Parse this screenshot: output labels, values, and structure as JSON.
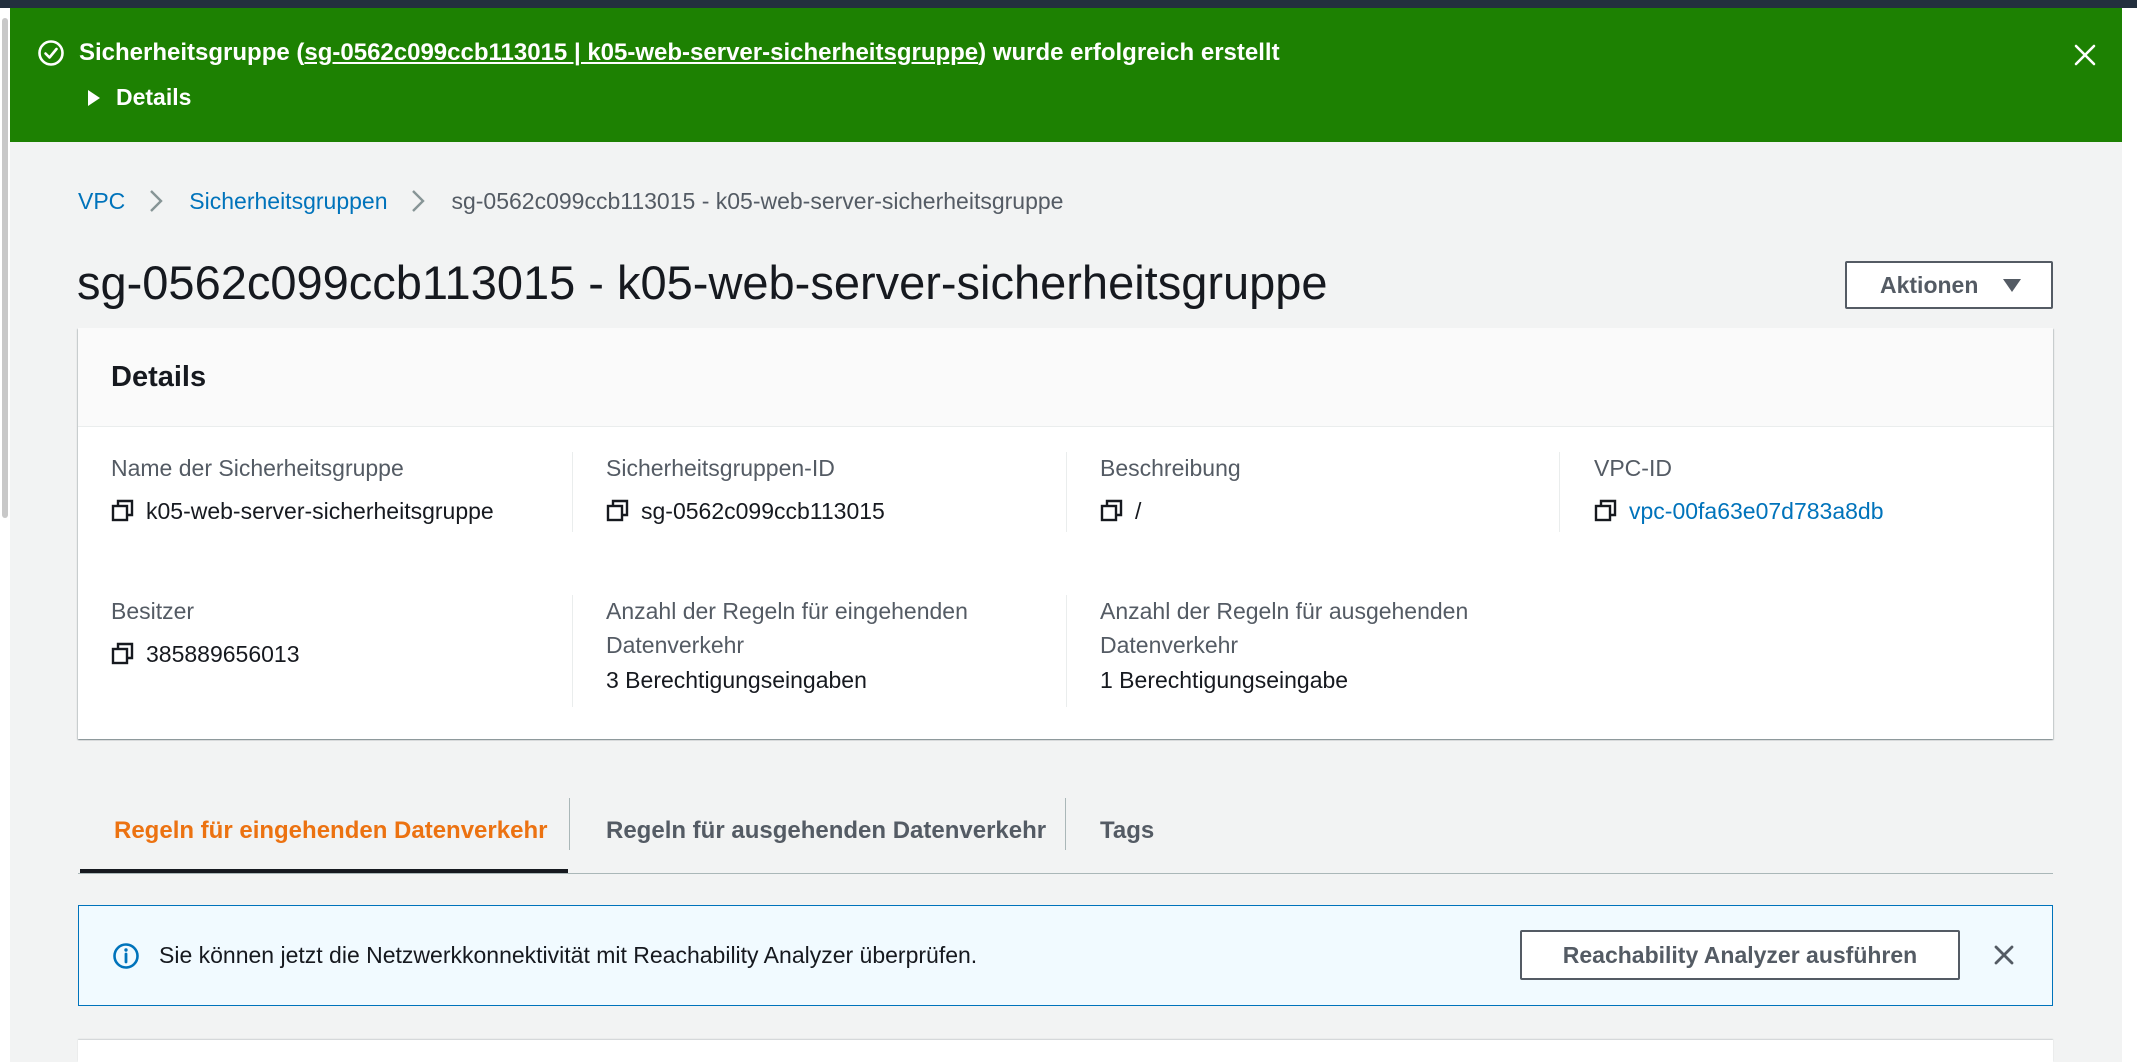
{
  "flash": {
    "prefix": "Sicherheitsgruppe (",
    "link_text": "sg-0562c099ccb113015 | k05-web-server-sicherheitsgruppe",
    "suffix": ") wurde erfolgreich erstellt",
    "details_label": "Details",
    "bg_color": "#1d8102"
  },
  "breadcrumb": {
    "items": [
      "VPC",
      "Sicherheitsgruppen"
    ],
    "current": "sg-0562c099ccb113015 - k05-web-server-sicherheitsgruppe"
  },
  "page": {
    "title": "sg-0562c099ccb113015 - k05-web-server-sicherheitsgruppe",
    "actions_label": "Aktionen"
  },
  "details": {
    "heading": "Details",
    "fields": [
      {
        "label": "Name der Sicherheitsgruppe",
        "value": "k05-web-server-sicherheitsgruppe"
      },
      {
        "label": "Sicherheitsgruppen-ID",
        "value": "sg-0562c099ccb113015"
      },
      {
        "label": "Beschreibung",
        "value": "/"
      },
      {
        "label": "VPC-ID",
        "value": "vpc-00fa63e07d783a8db"
      },
      {
        "label": "Besitzer",
        "value": "385889656013"
      },
      {
        "label": "Anzahl der Regeln für eingehenden Datenverkehr",
        "value": "3 Berechtigungseingaben"
      },
      {
        "label": "Anzahl der Regeln für ausgehenden Datenverkehr",
        "value": "1 Berechtigungseingabe"
      }
    ]
  },
  "tabs": [
    {
      "label": "Regeln für eingehenden Datenverkehr",
      "active": true
    },
    {
      "label": "Regeln für ausgehenden Datenverkehr",
      "active": false
    },
    {
      "label": "Tags",
      "active": false
    }
  ],
  "info_alert": {
    "text": "Sie können jetzt die Netzwerkkonnektivität mit Reachability Analyzer überprüfen.",
    "button_label": "Reachability Analyzer ausführen"
  },
  "colors": {
    "link": "#0073bb",
    "active_tab": "#ec7211",
    "success": "#1d8102",
    "info_bg": "#f1faff"
  },
  "icons": [
    "success-check-icon",
    "close-icon",
    "copy-icon",
    "info-icon",
    "chevron-right-icon",
    "caret-down-icon",
    "caret-right-icon"
  ]
}
